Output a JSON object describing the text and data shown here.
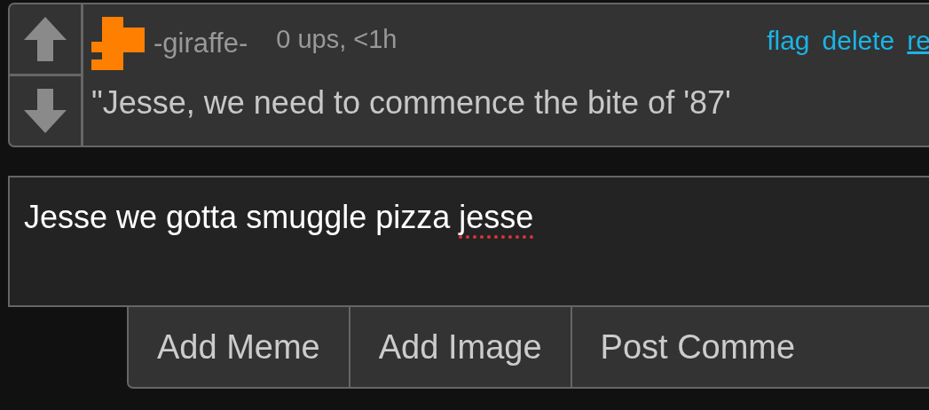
{
  "comment": {
    "username": "-giraffe-",
    "meta": "0 ups, <1h",
    "links": [
      {
        "label": "flag",
        "underlined": false
      },
      {
        "label": "delete",
        "underlined": false
      },
      {
        "label": "re",
        "underlined": true
      }
    ],
    "text": "\"Jesse, we need to commence the bite of '87'"
  },
  "reply_field": {
    "value_parts": [
      {
        "text": "Jesse we gotta smuggle pizza ",
        "misspelled": false
      },
      {
        "text": "jesse",
        "misspelled": true
      }
    ]
  },
  "buttons": [
    "Add Meme",
    "Add Image",
    "Post Comme"
  ]
}
